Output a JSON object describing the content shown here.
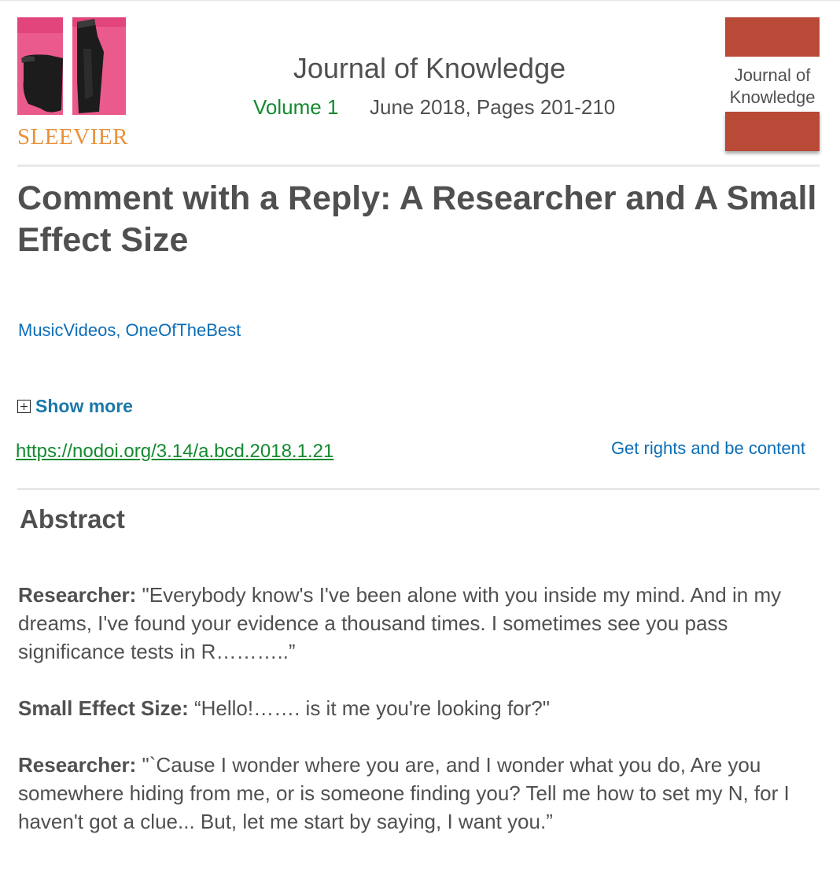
{
  "publisher": {
    "logo_text": "SLEEVIER",
    "logo_image": "two-black-arm-sleeves-photo",
    "logo_color": "#e8913b"
  },
  "journal": {
    "title": "Journal of Knowledge",
    "volume": "Volume 1",
    "issue_date": "June 2018, Pages 201-210",
    "cover_label": "Journal of Knowledge",
    "cover_color": "#b84a37"
  },
  "article": {
    "title": "Comment with a Reply: A Researcher and A Small Effect Size",
    "authors": "MusicVideos, OneOfTheBest",
    "show_more_label": "Show more",
    "show_more_icon": "plus-box-icon",
    "doi": "https://nodoi.org/3.14/a.bcd.2018.1.21",
    "rights_link": "Get rights and be content"
  },
  "abstract": {
    "heading": "Abstract",
    "paragraphs": [
      {
        "speaker": "Researcher:",
        "text": " \"Everybody know's I've been alone with you inside my mind. And in my dreams, I've found your evidence a thousand times. I sometimes see you pass significance tests in R………..”"
      },
      {
        "speaker": "Small Effect Size:",
        "text": " “Hello!……. is it me you're looking for?\""
      },
      {
        "speaker": "Researcher:",
        "text": " \"`Cause I wonder where you are, and I wonder what you do, Are you somewhere hiding from me, or is someone finding you? Tell me how to set my N, for I haven't got a clue... But, let me start by saying, I want you.”"
      }
    ]
  },
  "colors": {
    "link_blue": "#0c6db6",
    "doi_green": "#138a30",
    "text_gray": "#505050",
    "show_more_blue": "#1b78a8"
  }
}
